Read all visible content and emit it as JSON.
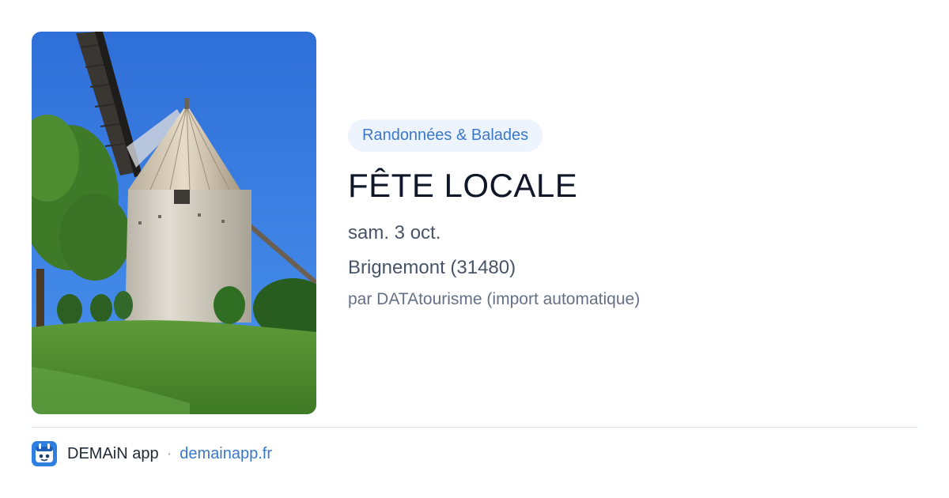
{
  "event": {
    "category": "Randonnées & Balades",
    "title": "FÊTE LOCALE",
    "date": "sam. 3 oct.",
    "location": "Brignemont (31480)",
    "author": "par DATAtourisme (import automatique)"
  },
  "footer": {
    "app_name": "DEMAiN app",
    "separator": "·",
    "site": "demainapp.fr",
    "logo_icon": "demain-app-logo-icon"
  },
  "colors": {
    "accent": "#3a78c9",
    "tag_background": "#eef4fd",
    "title": "#101828",
    "muted": "#475467"
  }
}
